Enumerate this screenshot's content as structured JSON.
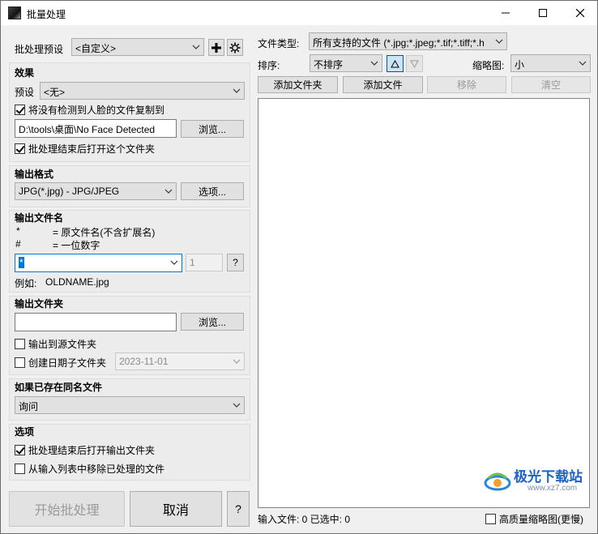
{
  "window": {
    "title": "批量处理"
  },
  "preset_row": {
    "label": "批处理预设",
    "value": "<自定义>"
  },
  "effects": {
    "heading": "效果",
    "preset_label": "预设",
    "preset_value": "<无>",
    "copy_no_face_label": "将没有检测到人脸的文件复制到",
    "copy_no_face_checked": true,
    "no_face_path": "D:\\tools\\桌面\\No Face Detected",
    "browse_label": "浏览...",
    "open_folder_label": "批处理结束后打开这个文件夹",
    "open_folder_checked": true
  },
  "output_format": {
    "heading": "输出格式",
    "value": "JPG(*.jpg) - JPG/JPEG",
    "options_label": "选项..."
  },
  "output_filename": {
    "heading": "输出文件名",
    "legend1_sym": "*",
    "legend1_desc": "= 原文件名(不含扩展名)",
    "legend2_sym": "#",
    "legend2_desc": "= 一位数字",
    "pattern": "*",
    "start_number": "1",
    "help_label": "?",
    "example_label": "例如:",
    "example_value": "OLDNAME.jpg"
  },
  "output_folder": {
    "heading": "输出文件夹",
    "path": "",
    "browse_label": "浏览...",
    "to_source_label": "输出到源文件夹",
    "to_source_checked": false,
    "date_subfolder_label": "创建日期子文件夹",
    "date_subfolder_checked": false,
    "date_value": "2023-11-01"
  },
  "if_exists": {
    "heading": "如果已存在同名文件",
    "value": "询问"
  },
  "options": {
    "heading": "选项",
    "open_output_label": "批处理结束后打开输出文件夹",
    "open_output_checked": true,
    "remove_processed_label": "从输入列表中移除已处理的文件",
    "remove_processed_checked": false
  },
  "actions": {
    "start_label": "开始批处理",
    "cancel_label": "取消",
    "help_label": "?"
  },
  "file_panel": {
    "type_label": "文件类型:",
    "type_value": "所有支持的文件 (*.jpg;*.jpeg;*.tif;*.tiff;*.h",
    "sort_label": "排序:",
    "sort_value": "不排序",
    "thumb_label": "缩略图:",
    "thumb_value": "小",
    "add_folder_label": "添加文件夹",
    "add_file_label": "添加文件",
    "remove_label": "移除",
    "clear_label": "清空",
    "status_text": "输入文件: 0  已选中: 0",
    "hq_thumb_label": "高质量缩略图(更慢)",
    "hq_thumb_checked": false
  },
  "watermark": {
    "text": "极光下载站",
    "sub": "www.xz7.com"
  }
}
